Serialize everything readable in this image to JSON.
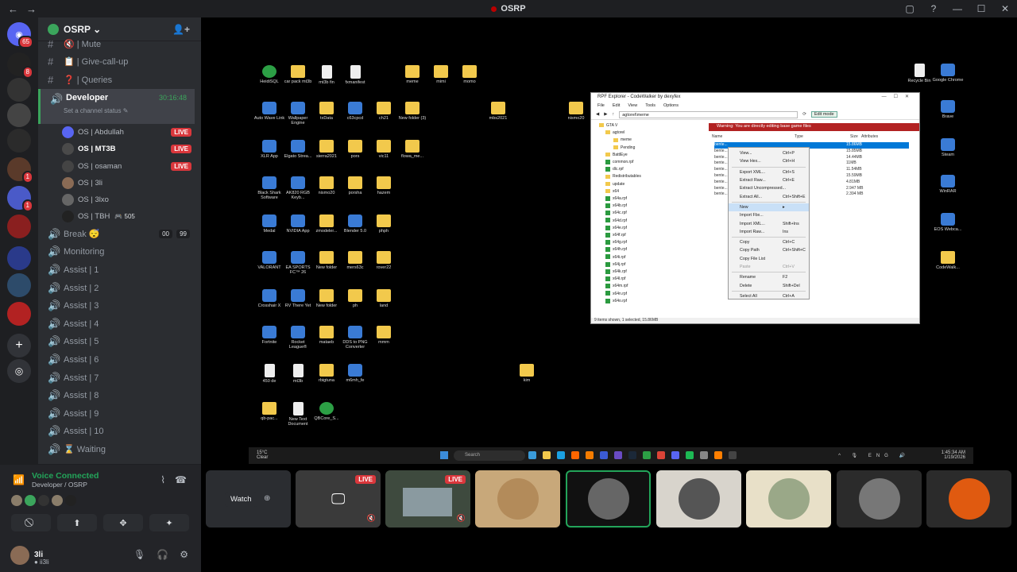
{
  "window": {
    "title": "OSRP",
    "back_icon": "←",
    "forward_icon": "→",
    "controls": [
      "▢",
      "?",
      "—",
      "☐",
      "✕"
    ]
  },
  "rail": {
    "badges": {
      "home": "65",
      "s1": "8",
      "s2": "1",
      "s3": "1",
      "s4": "1"
    }
  },
  "server": {
    "name": "OSRP ⌄"
  },
  "channels": {
    "top": [
      {
        "icon": "#",
        "label": "🔇 | Mute"
      },
      {
        "icon": "#",
        "label": "📋 | Give-call-up"
      },
      {
        "icon": "#",
        "label": "❓ | Queries"
      }
    ],
    "developer": {
      "label": "Developer",
      "time": "30:16:48",
      "status": "Set a channel status ✎"
    },
    "voice_users": [
      {
        "name": "OS | Abdullah",
        "live": "LIVE"
      },
      {
        "name": "OS | MT3B",
        "live": "LIVE"
      },
      {
        "name": "OS | osaman",
        "live": "LIVE"
      },
      {
        "name": "OS | 3li",
        "live": ""
      },
      {
        "name": "OS | 3lxo",
        "live": ""
      },
      {
        "name": "OS | TBH",
        "live": "",
        "extra": "🎮 505"
      }
    ],
    "break": {
      "label": "Break 😴",
      "pills": [
        "00",
        "99"
      ]
    },
    "others": [
      "Monitoring",
      "Assist | 1",
      "Assist | 2",
      "Assist | 3",
      "Assist | 4",
      "Assist | 5",
      "Assist | 6",
      "Assist | 7",
      "Assist | 8",
      "Assist | 9",
      "Assist | 10",
      "⌛ Waiting"
    ]
  },
  "voice": {
    "status": "Voice Connected",
    "location": "Developer / OSRP",
    "actions": [
      "⃠",
      "⬆",
      "✥",
      "✦"
    ]
  },
  "user": {
    "name": "3li",
    "tag": "● ii3li"
  },
  "desktop": {
    "icons": [
      {
        "label": "HeidiSQL",
        "kind": "green"
      },
      {
        "label": "car pack mt3b",
        "kind": "folder"
      },
      {
        "label": "mt3b fin",
        "kind": "doc"
      },
      {
        "label": "fxmanifest",
        "kind": "doc"
      },
      {
        "label": "meme",
        "kind": "folder"
      },
      {
        "label": "mimi",
        "kind": "folder"
      },
      {
        "label": "momo",
        "kind": "folder"
      },
      {
        "label": "Auto Wave Link",
        "kind": "app"
      },
      {
        "label": "Wallpaper Engine",
        "kind": "app"
      },
      {
        "label": "txData",
        "kind": "folder"
      },
      {
        "label": "c63cpcd",
        "kind": "app"
      },
      {
        "label": "ch21",
        "kind": "folder"
      },
      {
        "label": "New folder (3)",
        "kind": "folder"
      },
      {
        "label": "mbs2021",
        "kind": "folder"
      },
      {
        "label": "XLR App",
        "kind": "app"
      },
      {
        "label": "Elgato Strea...",
        "kind": "app"
      },
      {
        "label": "sierra2021",
        "kind": "folder"
      },
      {
        "label": "pors",
        "kind": "folder"
      },
      {
        "label": "vic11",
        "kind": "folder"
      },
      {
        "label": "flowa_me...",
        "kind": "folder"
      },
      {
        "label": "Black Shark Software",
        "kind": "app"
      },
      {
        "label": "AK820 RGB Keyb...",
        "kind": "app"
      },
      {
        "label": "nismo20",
        "kind": "folder"
      },
      {
        "label": "porsha",
        "kind": "folder"
      },
      {
        "label": "hazem",
        "kind": "folder"
      },
      {
        "label": "Medal",
        "kind": "app"
      },
      {
        "label": "NVIDIA App",
        "kind": "app"
      },
      {
        "label": "zmodeler...",
        "kind": "folder"
      },
      {
        "label": "Blender 5.0",
        "kind": "app"
      },
      {
        "label": "phph",
        "kind": "folder"
      },
      {
        "label": "VALORANT",
        "kind": "app"
      },
      {
        "label": "EA SPORTS FC™ 26",
        "kind": "app"
      },
      {
        "label": "New folder",
        "kind": "folder"
      },
      {
        "label": "mers63c",
        "kind": "folder"
      },
      {
        "label": "rover22",
        "kind": "folder"
      },
      {
        "label": "Crosshair X",
        "kind": "app"
      },
      {
        "label": "RV There Yet",
        "kind": "app"
      },
      {
        "label": "New folder",
        "kind": "folder"
      },
      {
        "label": "ph",
        "kind": "folder"
      },
      {
        "label": "land",
        "kind": "folder"
      },
      {
        "label": "Fortnite",
        "kind": "app"
      },
      {
        "label": "Rocket League®",
        "kind": "app"
      },
      {
        "label": "mataeb",
        "kind": "folder"
      },
      {
        "label": "DDS to PNG Converter",
        "kind": "app"
      },
      {
        "label": "mmm",
        "kind": "folder"
      },
      {
        "label": "450 de",
        "kind": "doc"
      },
      {
        "label": "mt3b",
        "kind": "doc"
      },
      {
        "label": "rbigtuna",
        "kind": "folder"
      },
      {
        "label": "m6mh_fe",
        "kind": "app"
      },
      {
        "label": "kim",
        "kind": "folder"
      },
      {
        "label": "qb-pac...",
        "kind": "folder"
      },
      {
        "label": "New Text Document",
        "kind": "doc"
      },
      {
        "label": "QBCore_S...",
        "kind": "green"
      },
      {
        "label": "Recycle Bin",
        "kind": "doc"
      },
      {
        "label": "Google Chrome",
        "kind": "app"
      },
      {
        "label": "Brave",
        "kind": "app"
      },
      {
        "label": "Steam",
        "kind": "app"
      },
      {
        "label": "WinRAR",
        "kind": "app"
      },
      {
        "label": "EOS Webca...",
        "kind": "app"
      },
      {
        "label": "CodeWalk...",
        "kind": "folder"
      },
      {
        "label": "nismo20",
        "kind": "folder"
      }
    ]
  },
  "rpf": {
    "title": "RPF Explorer - CodeWalker by dexyfex",
    "menu": [
      "File",
      "Edit",
      "View",
      "Tools",
      "Options"
    ],
    "path": "agtorel\\meme",
    "edit_mode": "Edit mode",
    "tree": [
      "GTA V",
      "agtorel",
      "meme",
      "Pending",
      "BattlEye",
      "common.rpf",
      "dlc.rpf",
      "Redistributables",
      "update",
      "x64",
      "x64a.rpf",
      "x64b.rpf",
      "x64c.rpf",
      "x64d.rpf",
      "x64e.rpf",
      "x64f.rpf",
      "x64g.rpf",
      "x64h.rpf",
      "x64i.rpf",
      "x64j.rpf",
      "x64k.rpf",
      "x64l.rpf",
      "x64m.rpf",
      "x64n.rpf",
      "x64o.rpf"
    ],
    "warning": "Warning: You are directly editing base game files",
    "columns": [
      "Name",
      "Type",
      "Size",
      "Attributes"
    ],
    "files": [
      {
        "name": "bente...",
        "size": "15.86MB"
      },
      {
        "name": "bente...",
        "size": "15.85MB"
      },
      {
        "name": "bente...",
        "size": "14.44MB"
      },
      {
        "name": "bente...",
        "size": "11MB"
      },
      {
        "name": "bente...",
        "size": "11.54MB"
      },
      {
        "name": "bente...",
        "size": "15.59MB"
      },
      {
        "name": "bente...",
        "size": "4.81MB"
      },
      {
        "name": "bente...",
        "size": "2.947 MB"
      },
      {
        "name": "bente...",
        "size": "2.394 MB"
      }
    ],
    "status": "9 items shown, 1 selected, 15.86MB",
    "context": [
      {
        "label": "View...",
        "key": "Ctrl+P"
      },
      {
        "label": "View Hex...",
        "key": "Ctrl+H"
      },
      {
        "sep": true
      },
      {
        "label": "Export XML...",
        "key": "Ctrl+S"
      },
      {
        "label": "Extract Raw...",
        "key": "Ctrl+E"
      },
      {
        "label": "Extract Uncompressed...",
        "key": ""
      },
      {
        "label": "Extract All...",
        "key": "Ctrl+Shift+E"
      },
      {
        "sep": true
      },
      {
        "label": "New",
        "key": "▸",
        "hl": true
      },
      {
        "label": "Import Fbx...",
        "key": ""
      },
      {
        "label": "Import XML...",
        "key": "Shift+Ins"
      },
      {
        "label": "Import Raw...",
        "key": "Ins"
      },
      {
        "sep": true
      },
      {
        "label": "Copy",
        "key": "Ctrl+C"
      },
      {
        "label": "Copy Path",
        "key": "Ctrl+Shift+C"
      },
      {
        "label": "Copy File List",
        "key": ""
      },
      {
        "label": "Paste",
        "key": "Ctrl+V",
        "dis": true
      },
      {
        "sep": true
      },
      {
        "label": "Rename",
        "key": "F2"
      },
      {
        "label": "Delete",
        "key": "Shift+Del"
      },
      {
        "sep": true
      },
      {
        "label": "Select All",
        "key": "Ctrl+A"
      }
    ]
  },
  "taskbar": {
    "weather_temp": "15°C",
    "weather_desc": "Clear",
    "search": "Search",
    "lang": "ENG",
    "time": "1:45:34 AM",
    "date": "1/19/2026"
  },
  "streams": {
    "watch": "Watch",
    "live": "LIVE"
  }
}
